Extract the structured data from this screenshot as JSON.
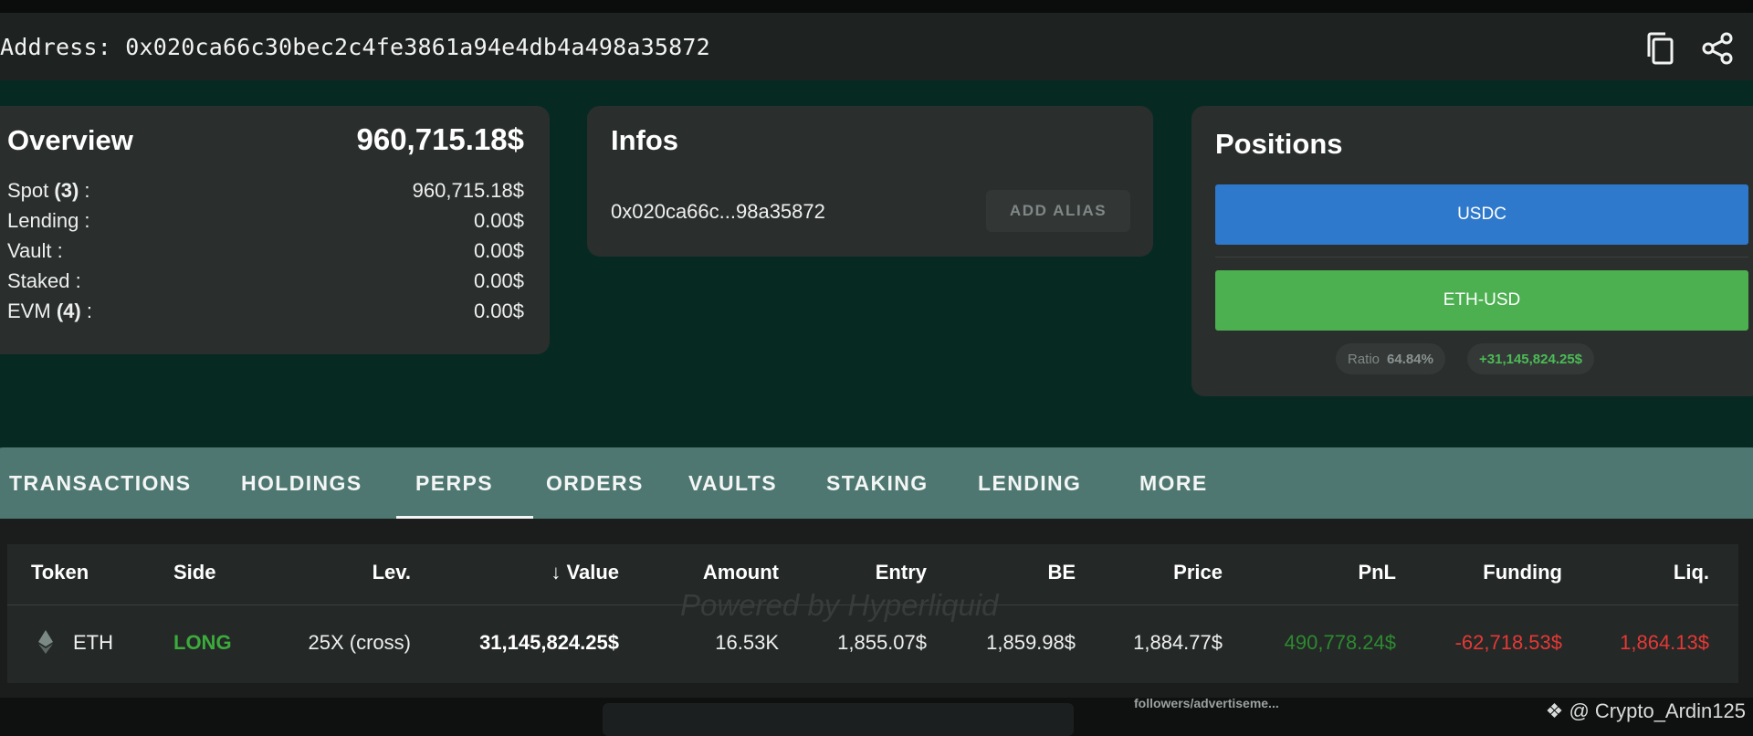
{
  "address_bar": {
    "label": "Address:",
    "address": "0x020ca66c30bec2c4fe3861a94e4db4a498a35872"
  },
  "overview": {
    "title": "Overview",
    "total": "960,715.18$",
    "rows": [
      {
        "label": "Spot",
        "count": "(3)",
        "suffix": " :",
        "value": "960,715.18$"
      },
      {
        "label": "Lending :",
        "count": "",
        "suffix": "",
        "value": "0.00$"
      },
      {
        "label": "Vault :",
        "count": "",
        "suffix": "",
        "value": "0.00$"
      },
      {
        "label": "Staked :",
        "count": "",
        "suffix": "",
        "value": "0.00$"
      },
      {
        "label": "EVM",
        "count": "(4)",
        "suffix": " :",
        "value": "0.00$"
      }
    ]
  },
  "infos": {
    "title": "Infos",
    "short_address": "0x020ca66c...98a35872",
    "alias_button": "ADD ALIAS"
  },
  "positions": {
    "title": "Positions",
    "bars": [
      "USDC",
      "ETH-USD"
    ],
    "ratio_label": "Ratio",
    "ratio_value": "64.84%",
    "total_value": "+31,145,824.25$"
  },
  "tabs": [
    "TRANSACTIONS",
    "HOLDINGS",
    "PERPS",
    "ORDERS",
    "VAULTS",
    "STAKING",
    "LENDING",
    "MORE"
  ],
  "active_tab": "PERPS",
  "table": {
    "headers": [
      "Token",
      "Side",
      "Lev.",
      "↓ Value",
      "Amount",
      "Entry",
      "BE",
      "Price",
      "PnL",
      "Funding",
      "Liq."
    ],
    "rows": [
      {
        "token": "ETH",
        "side": "LONG",
        "lev": "25X (cross)",
        "value": "31,145,824.25$",
        "amount": "16.53K",
        "entry": "1,855.07$",
        "be": "1,859.98$",
        "price": "1,884.77$",
        "pnl": "490,778.24$",
        "funding": "-62,718.53$",
        "liq": "1,864.13$"
      }
    ]
  },
  "watermark": "Powered by Hyperliquid",
  "footer": {
    "text": "followers/advertiseme...",
    "credit": "@ Crypto_Ardin125"
  },
  "colors": {
    "positive": "#3cab3c",
    "negative": "#e53935",
    "usdc_bar": "#2f79cc",
    "eth_bar": "#4caf50",
    "tab_bar": "#4e7771"
  }
}
